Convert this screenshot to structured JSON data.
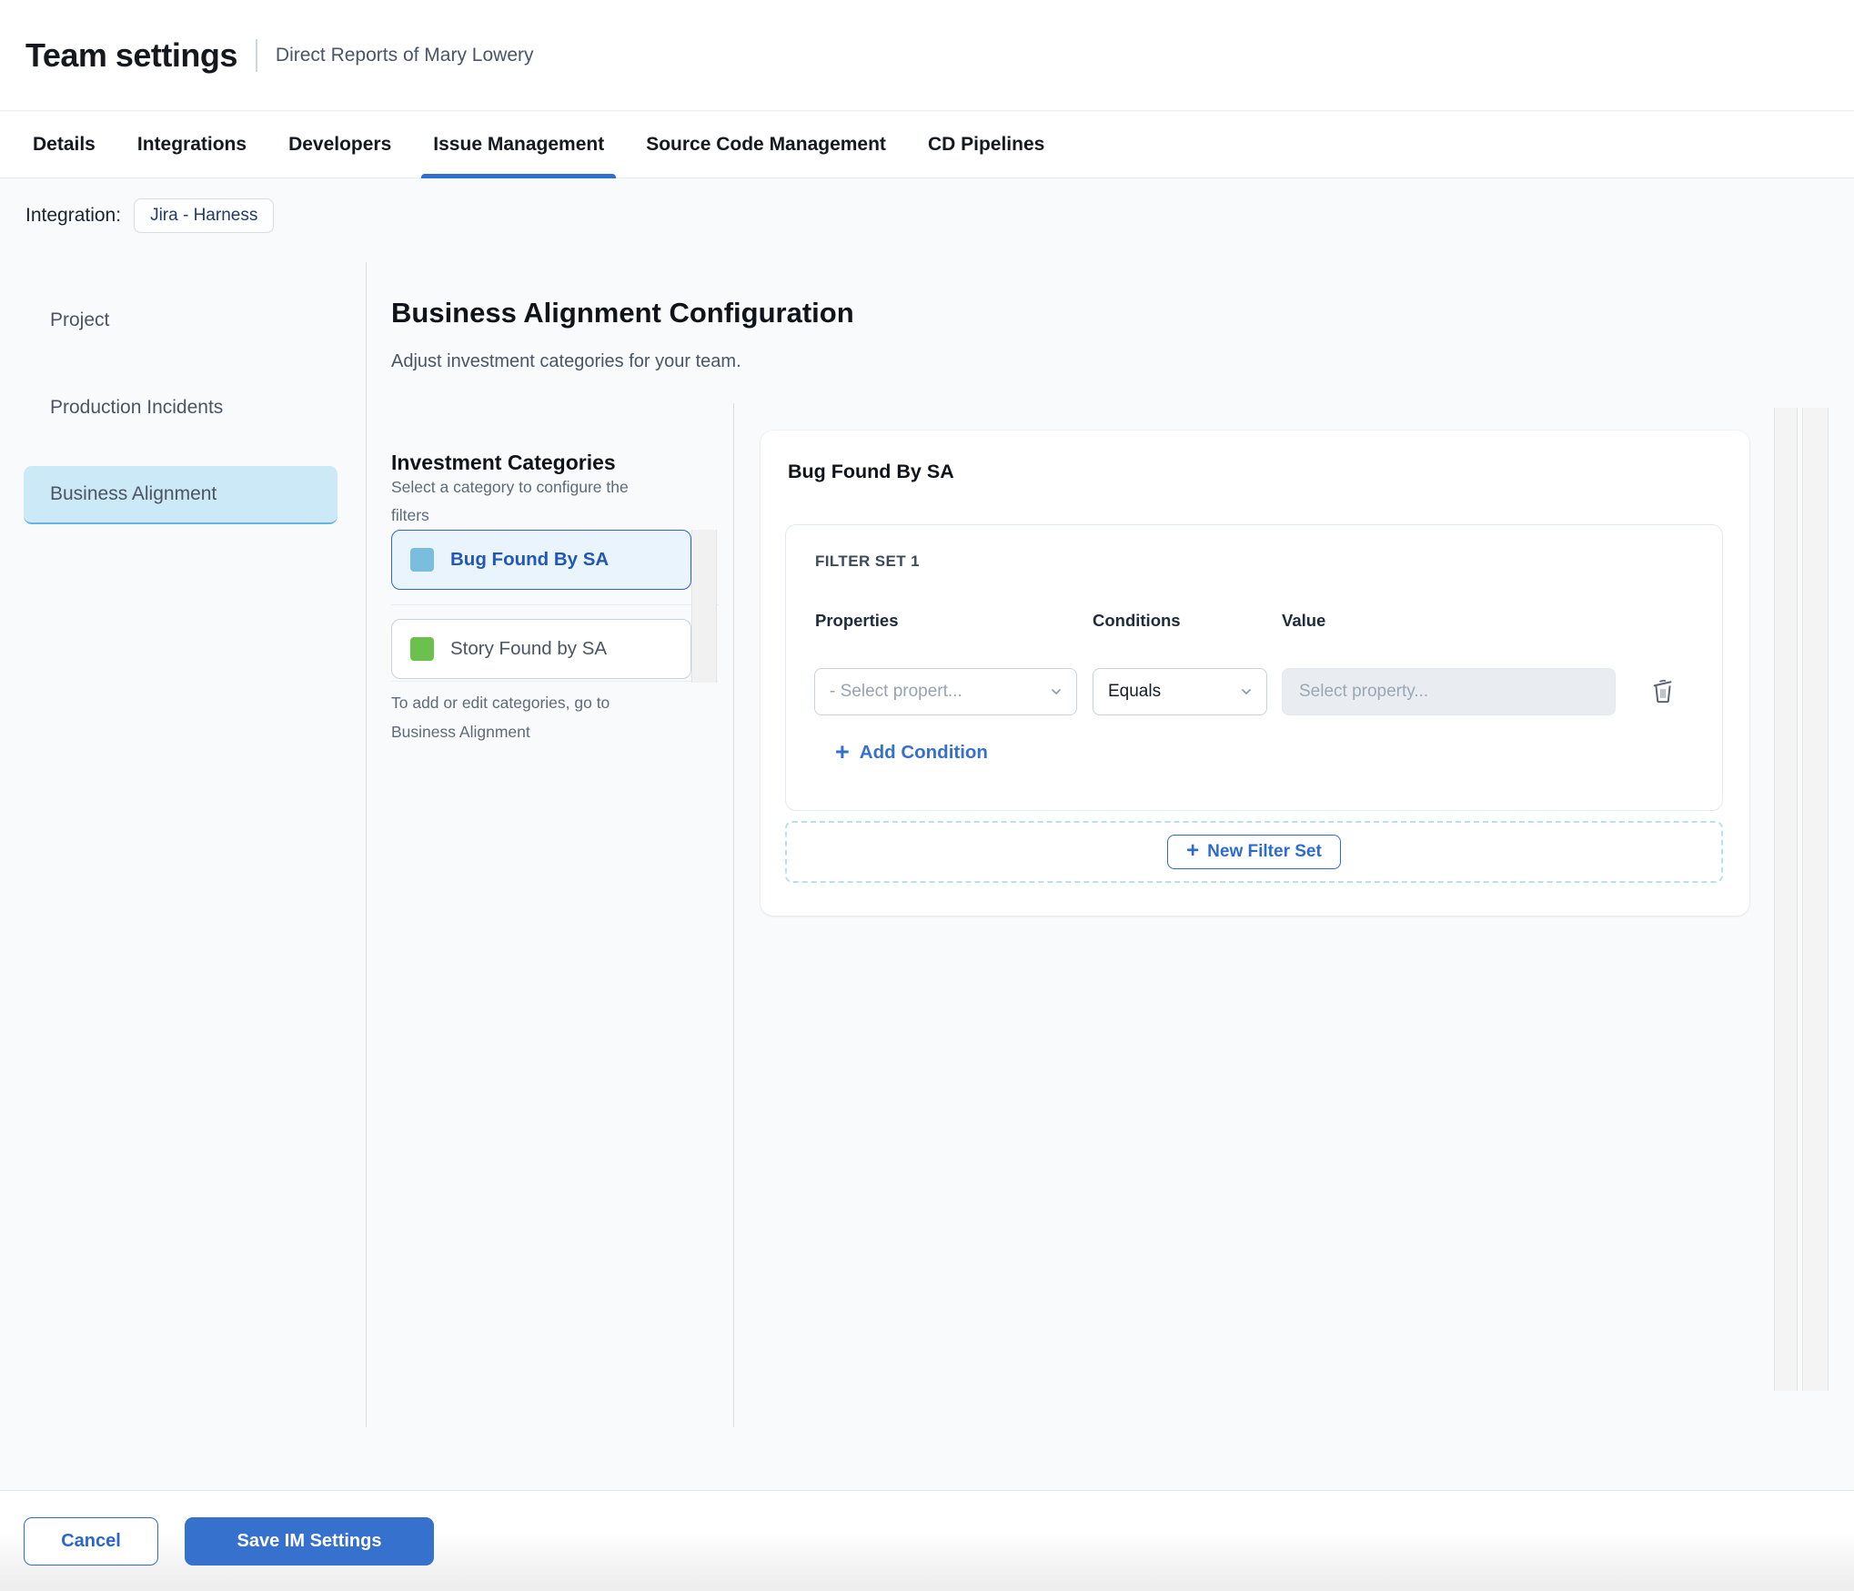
{
  "header": {
    "title": "Team settings",
    "subtitle": "Direct Reports of Mary Lowery"
  },
  "tabs": [
    {
      "label": "Details",
      "active": false
    },
    {
      "label": "Integrations",
      "active": false
    },
    {
      "label": "Developers",
      "active": false
    },
    {
      "label": "Issue Management",
      "active": true
    },
    {
      "label": "Source Code Management",
      "active": false
    },
    {
      "label": "CD Pipelines",
      "active": false
    }
  ],
  "integration": {
    "label": "Integration:",
    "value": "Jira - Harness"
  },
  "sidebar": {
    "items": [
      {
        "label": "Project",
        "selected": false
      },
      {
        "label": "Production Incidents",
        "selected": false
      },
      {
        "label": "Business Alignment",
        "selected": true
      }
    ]
  },
  "main": {
    "title": "Business Alignment Configuration",
    "subtitle": "Adjust investment categories for your team.",
    "categories": {
      "heading": "Investment Categories",
      "hint": "Select a category to configure the filters",
      "items": [
        {
          "label": "Bug Found By SA",
          "swatch_color": "#7bbddd",
          "selected": true
        },
        {
          "label": "Story Found by SA",
          "swatch_color": "#6cc14e",
          "selected": false
        }
      ],
      "footnote": "To add or edit categories, go to Business Alignment"
    },
    "panel": {
      "title": "Bug Found By SA",
      "filter_set": {
        "label": "FILTER SET 1",
        "columns": {
          "properties": "Properties",
          "conditions": "Conditions",
          "value": "Value"
        },
        "property_placeholder": "- Select propert...",
        "condition_value": "Equals",
        "value_placeholder": "Select property...",
        "add_condition_label": "Add Condition"
      },
      "new_filter_set_label": "New Filter Set"
    }
  },
  "footer": {
    "cancel_label": "Cancel",
    "save_label": "Save IM Settings"
  },
  "colors": {
    "active_tab_underline": "#2f6fd0",
    "sidebar_selected_bg": "#cbe9f7",
    "category_selected_bg": "#e9f4fc",
    "category_selected_border": "#2d66c3",
    "link_blue": "#3570cf",
    "save_button_bg": "#3571cd",
    "swatch_blue": "#7bbddd",
    "swatch_green": "#6cc14e",
    "content_bg": "#f8fafc"
  }
}
